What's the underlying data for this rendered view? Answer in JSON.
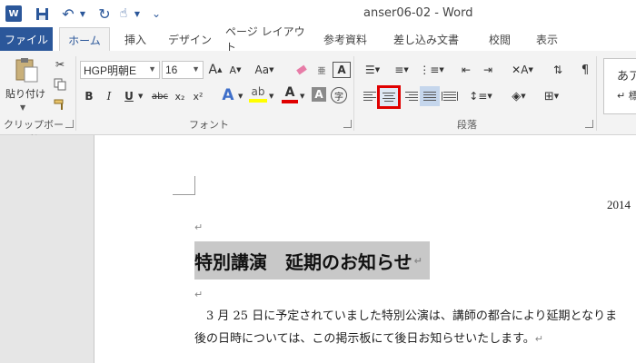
{
  "window": {
    "title": "anser06-02 - Word"
  },
  "qat": {
    "logo": "W",
    "undo": "↶",
    "redo": "↻",
    "touch": "☝",
    "customize": "⌄"
  },
  "tabs": [
    "ファイル",
    "ホーム",
    "挿入",
    "デザイン",
    "ページ レイアウト",
    "参考資料",
    "差し込み文書",
    "校閲",
    "表示"
  ],
  "clipboard": {
    "paste_label": "貼り付け",
    "group_label": "クリップボード"
  },
  "font": {
    "name": "HGP明朝E",
    "size": "16",
    "group_label": "フォント",
    "grow": "A",
    "shrink": "A",
    "case": "Aa",
    "bold": "B",
    "italic": "I",
    "underline": "U",
    "strike": "abc",
    "subscript": "x₂",
    "superscript": "x²",
    "effects": "A",
    "font_color": "A",
    "char_shade": "A",
    "enclose": "字",
    "clear_format": "A"
  },
  "paragraph": {
    "group_label": "段落"
  },
  "styles": {
    "sample": "あア",
    "label": "↵ 標"
  },
  "document": {
    "date": "2014",
    "heading": "特別講演　延期のお知らせ",
    "line1": "　3 月 25 日に予定されていました特別公演は、講師の都合により延期となりま",
    "line2": "後の日時については、この掲示板にて後日お知らせいたします。",
    "return_mark": "↵"
  },
  "colors": {
    "accent": "#2b579a",
    "highlight_box": "#e00000",
    "highlight_yellow": "#ffff00",
    "font_red": "#e00000"
  }
}
